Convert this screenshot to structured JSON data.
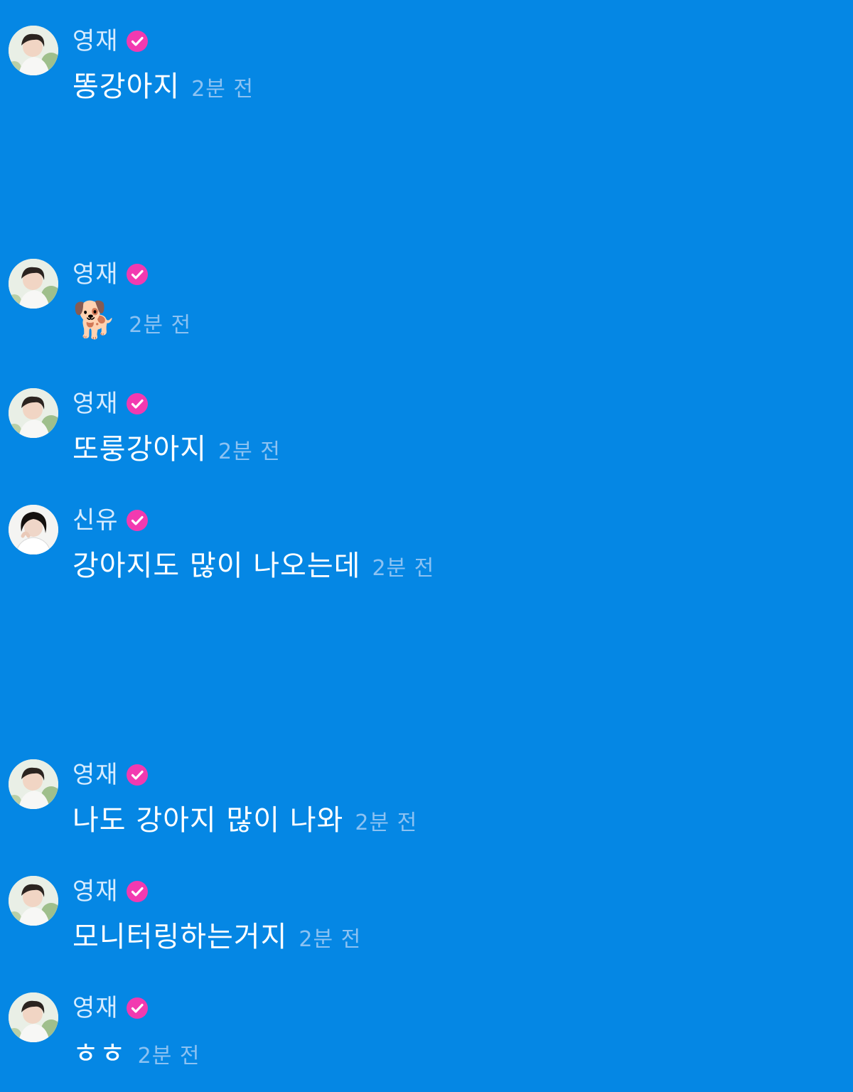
{
  "comments": [
    {
      "user": "영재",
      "verified": true,
      "text": "똥강아지",
      "time": "2분 전",
      "avatar": "youngjae-avatar"
    },
    {
      "user": "영재",
      "verified": true,
      "text": "🐕",
      "time": "2분 전",
      "avatar": "youngjae-avatar"
    },
    {
      "user": "영재",
      "verified": true,
      "text": "또룽강아지",
      "time": "2분 전",
      "avatar": "youngjae-avatar"
    },
    {
      "user": "신유",
      "verified": true,
      "text": "강아지도 많이 나오는데",
      "time": "2분 전",
      "avatar": "shinyu-avatar"
    },
    {
      "user": "영재",
      "verified": true,
      "text": "나도 강아지 많이 나와",
      "time": "2분 전",
      "avatar": "youngjae-avatar"
    },
    {
      "user": "영재",
      "verified": true,
      "text": "모니터링하는거지",
      "time": "2분 전",
      "avatar": "youngjae-avatar"
    },
    {
      "user": "영재",
      "verified": true,
      "text": "ㅎㅎ",
      "time": "2분 전",
      "avatar": "youngjae-avatar"
    }
  ],
  "colors": {
    "background": "#0587e4",
    "verified_badge": "#f23ab0",
    "timestamp": "#8cc2f2",
    "username": "#d7ecff"
  }
}
